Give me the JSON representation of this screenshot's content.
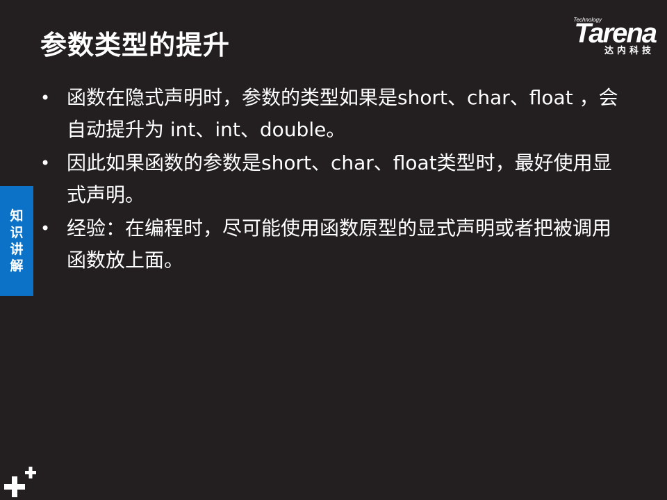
{
  "slide": {
    "title": "参数类型的提升",
    "logo": {
      "tech": "Technology",
      "word": "Tarena",
      "cn": "达内科技"
    },
    "side_tab": [
      "知",
      "识",
      "讲",
      "解"
    ],
    "bullets": [
      {
        "marker": "•",
        "text": "函数在隐式声明时，参数的类型如果是short、char、float ，会自动提升为 int、int、double。"
      },
      {
        "marker": "•",
        "text": "因此如果函数的参数是short、char、float类型时，最好使用显式声明。"
      },
      {
        "marker": "•",
        "text": "经验：在编程时，尽可能使用函数原型的显式声明或者把被调用函数放上面。"
      }
    ]
  },
  "colors": {
    "background": "#231f20",
    "text": "#ffffff",
    "tab": "#0b72c7"
  }
}
